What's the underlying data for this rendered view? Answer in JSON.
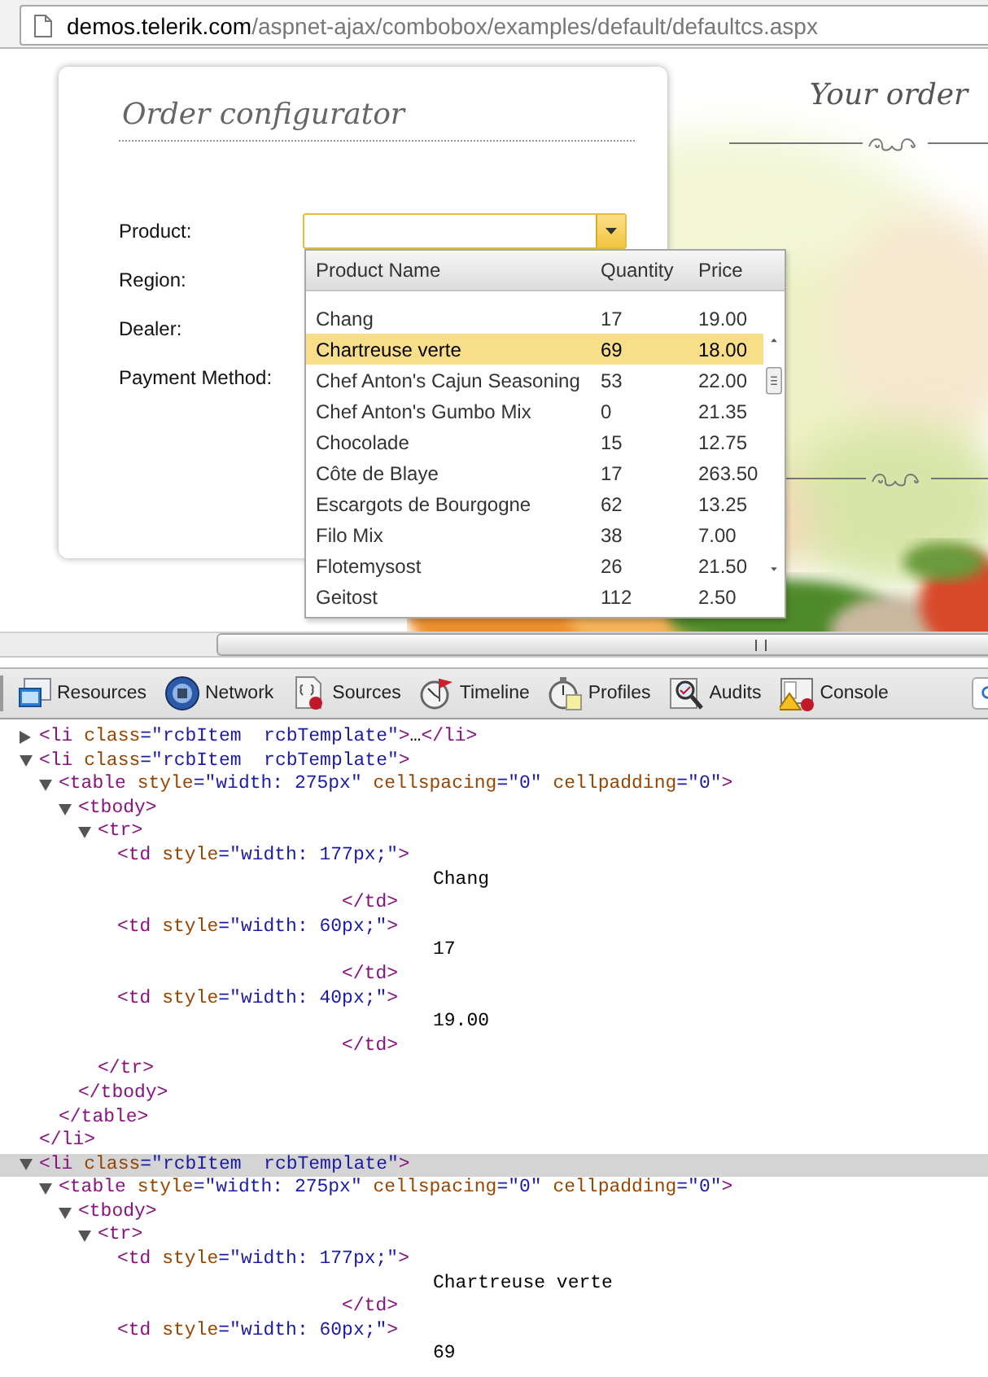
{
  "browser": {
    "url_host": "demos.telerik.com",
    "url_path": "/aspnet-ajax/combobox/examples/default/defaultcs.aspx"
  },
  "configurator": {
    "title": "Order configurator",
    "fields": [
      {
        "label": "Product:",
        "kind": "combobox",
        "expanded": true,
        "dropdown": {
          "columns": [
            "Product Name",
            "Quantity",
            "Price"
          ],
          "rows": [
            {
              "name": "Chang",
              "quantity": "17",
              "price": "19.00",
              "selected": false
            },
            {
              "name": "Chartreuse verte",
              "quantity": "69",
              "price": "18.00",
              "selected": true
            },
            {
              "name": "Chef Anton's Cajun Seasoning",
              "quantity": "53",
              "price": "22.00",
              "selected": false
            },
            {
              "name": "Chef Anton's Gumbo Mix",
              "quantity": "0",
              "price": "21.35",
              "selected": false
            },
            {
              "name": "Chocolade",
              "quantity": "15",
              "price": "12.75",
              "selected": false
            },
            {
              "name": "Côte de Blaye",
              "quantity": "17",
              "price": "263.50",
              "selected": false
            },
            {
              "name": "Escargots de Bourgogne",
              "quantity": "62",
              "price": "13.25",
              "selected": false
            },
            {
              "name": "Filo Mix",
              "quantity": "38",
              "price": "7.00",
              "selected": false
            },
            {
              "name": "Flotemysost",
              "quantity": "26",
              "price": "21.50",
              "selected": false
            },
            {
              "name": "Geitost",
              "quantity": "112",
              "price": "2.50",
              "selected": false
            }
          ]
        }
      },
      {
        "label": "Region:",
        "kind": "label"
      },
      {
        "label": "Dealer:",
        "kind": "label"
      },
      {
        "label": "Payment Method:",
        "kind": "label"
      }
    ]
  },
  "order_panel": {
    "title": "Your order"
  },
  "devtools": {
    "tabs": [
      {
        "label": "Resources",
        "kind": "resources"
      },
      {
        "label": "Network",
        "kind": "network"
      },
      {
        "label": "Sources",
        "kind": "sources"
      },
      {
        "label": "Timeline",
        "kind": "timeline"
      },
      {
        "label": "Profiles",
        "kind": "profiles"
      },
      {
        "label": "Audits",
        "kind": "audits"
      },
      {
        "label": "Console",
        "kind": "console"
      }
    ],
    "dom_tree": [
      {
        "kind": "element",
        "expanded": false,
        "selected": false,
        "open": [
          {
            "kind": "tag",
            "text": "<li"
          },
          {
            "kind": "attr",
            "text": " class"
          },
          {
            "kind": "value",
            "text": "=\"rcbItem  rcbTemplate\""
          },
          {
            "kind": "tag",
            "text": ">"
          }
        ],
        "close": [
          {
            "kind": "plain",
            "text": "…"
          },
          {
            "kind": "tag",
            "text": "</li>"
          }
        ]
      },
      {
        "kind": "element",
        "expanded": true,
        "selected": false,
        "open": [
          {
            "kind": "tag",
            "text": "<li"
          },
          {
            "kind": "attr",
            "text": " class"
          },
          {
            "kind": "value",
            "text": "=\"rcbItem  rcbTemplate\""
          },
          {
            "kind": "tag",
            "text": ">"
          }
        ],
        "close": [
          {
            "kind": "tag",
            "text": "</li>"
          }
        ],
        "children": [
          {
            "kind": "element",
            "expanded": true,
            "selected": false,
            "open": [
              {
                "kind": "tag",
                "text": "<table"
              },
              {
                "kind": "attr",
                "text": " style"
              },
              {
                "kind": "value",
                "text": "=\"width: 275px\""
              },
              {
                "kind": "attr",
                "text": " cellspacing"
              },
              {
                "kind": "value",
                "text": "=\"0\""
              },
              {
                "kind": "attr",
                "text": " cellpadding"
              },
              {
                "kind": "value",
                "text": "=\"0\""
              },
              {
                "kind": "tag",
                "text": ">"
              }
            ],
            "close": [
              {
                "kind": "tag",
                "text": "</table>"
              }
            ],
            "children": [
              {
                "kind": "element",
                "expanded": true,
                "selected": false,
                "open": [
                  {
                    "kind": "tag",
                    "text": "<tbody>"
                  }
                ],
                "close": [
                  {
                    "kind": "tag",
                    "text": "</tbody>"
                  }
                ],
                "children": [
                  {
                    "kind": "element",
                    "expanded": true,
                    "selected": false,
                    "open": [
                      {
                        "kind": "tag",
                        "text": "<tr>"
                      }
                    ],
                    "close": [
                      {
                        "kind": "tag",
                        "text": "</tr>"
                      }
                    ],
                    "children": [
                      {
                        "kind": "cell",
                        "selected": false,
                        "open": [
                          {
                            "kind": "tag",
                            "text": "<td"
                          },
                          {
                            "kind": "attr",
                            "text": " style"
                          },
                          {
                            "kind": "value",
                            "text": "=\"width: 177px;\""
                          },
                          {
                            "kind": "tag",
                            "text": ">"
                          }
                        ],
                        "close": [
                          {
                            "kind": "tag",
                            "text": "</td>"
                          }
                        ],
                        "children": [
                          {
                            "kind": "text",
                            "text": "Chang"
                          }
                        ]
                      },
                      {
                        "kind": "cell",
                        "selected": false,
                        "open": [
                          {
                            "kind": "tag",
                            "text": "<td"
                          },
                          {
                            "kind": "attr",
                            "text": " style"
                          },
                          {
                            "kind": "value",
                            "text": "=\"width: 60px;\""
                          },
                          {
                            "kind": "tag",
                            "text": ">"
                          }
                        ],
                        "close": [
                          {
                            "kind": "tag",
                            "text": "</td>"
                          }
                        ],
                        "children": [
                          {
                            "kind": "text",
                            "text": "17"
                          }
                        ]
                      },
                      {
                        "kind": "cell",
                        "selected": false,
                        "open": [
                          {
                            "kind": "tag",
                            "text": "<td"
                          },
                          {
                            "kind": "attr",
                            "text": " style"
                          },
                          {
                            "kind": "value",
                            "text": "=\"width: 40px;\""
                          },
                          {
                            "kind": "tag",
                            "text": ">"
                          }
                        ],
                        "close": [
                          {
                            "kind": "tag",
                            "text": "</td>"
                          }
                        ],
                        "children": [
                          {
                            "kind": "text",
                            "text": "19.00"
                          }
                        ]
                      }
                    ]
                  }
                ]
              }
            ]
          }
        ]
      },
      {
        "kind": "element",
        "expanded": true,
        "selected": true,
        "open": [
          {
            "kind": "tag",
            "text": "<li"
          },
          {
            "kind": "attr",
            "text": " class"
          },
          {
            "kind": "value",
            "text": "=\"rcbItem  rcbTemplate\""
          },
          {
            "kind": "tag",
            "text": ">"
          }
        ],
        "children": [
          {
            "kind": "element",
            "expanded": true,
            "selected": false,
            "open": [
              {
                "kind": "tag",
                "text": "<table"
              },
              {
                "kind": "attr",
                "text": " style"
              },
              {
                "kind": "value",
                "text": "=\"width: 275px\""
              },
              {
                "kind": "attr",
                "text": " cellspacing"
              },
              {
                "kind": "value",
                "text": "=\"0\""
              },
              {
                "kind": "attr",
                "text": " cellpadding"
              },
              {
                "kind": "value",
                "text": "=\"0\""
              },
              {
                "kind": "tag",
                "text": ">"
              }
            ],
            "children": [
              {
                "kind": "element",
                "expanded": true,
                "selected": false,
                "open": [
                  {
                    "kind": "tag",
                    "text": "<tbody>"
                  }
                ],
                "children": [
                  {
                    "kind": "element",
                    "expanded": true,
                    "selected": false,
                    "open": [
                      {
                        "kind": "tag",
                        "text": "<tr>"
                      }
                    ],
                    "children": [
                      {
                        "kind": "cell",
                        "selected": false,
                        "open": [
                          {
                            "kind": "tag",
                            "text": "<td"
                          },
                          {
                            "kind": "attr",
                            "text": " style"
                          },
                          {
                            "kind": "value",
                            "text": "=\"width: 177px;\""
                          },
                          {
                            "kind": "tag",
                            "text": ">"
                          }
                        ],
                        "close": [
                          {
                            "kind": "tag",
                            "text": "</td>"
                          }
                        ],
                        "children": [
                          {
                            "kind": "text",
                            "text": "Chartreuse verte"
                          }
                        ]
                      },
                      {
                        "kind": "cell",
                        "selected": false,
                        "open": [
                          {
                            "kind": "tag",
                            "text": "<td"
                          },
                          {
                            "kind": "attr",
                            "text": " style"
                          },
                          {
                            "kind": "value",
                            "text": "=\"width: 60px;\""
                          },
                          {
                            "kind": "tag",
                            "text": ">"
                          }
                        ],
                        "children": [
                          {
                            "kind": "text",
                            "text": "69"
                          }
                        ]
                      }
                    ]
                  }
                ]
              }
            ]
          }
        ]
      }
    ]
  }
}
